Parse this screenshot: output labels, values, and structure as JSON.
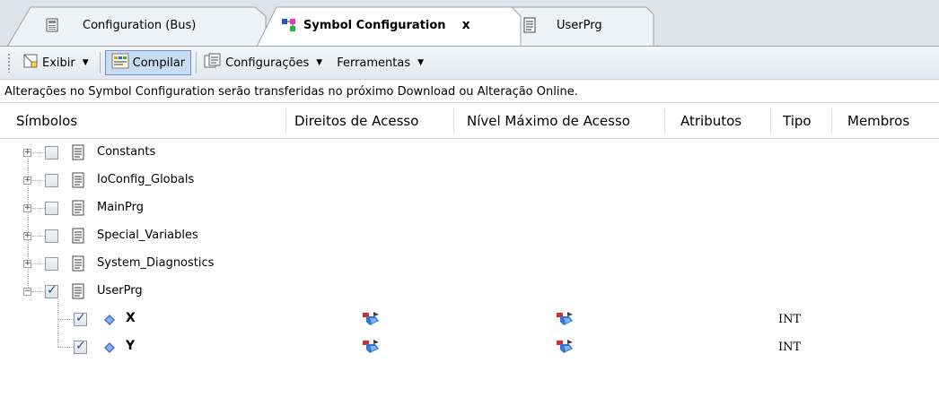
{
  "tabs": [
    {
      "label": "Configuration (Bus)",
      "icon": "bus-config-icon",
      "active": false
    },
    {
      "label": "Symbol Configuration",
      "icon": "symbol-config-icon",
      "active": true,
      "close": "x"
    },
    {
      "label": "UserPrg",
      "icon": "document-icon",
      "active": false
    }
  ],
  "toolbar": {
    "view_label": "Exibir",
    "compile_label": "Compilar",
    "settings_label": "Configurações",
    "tools_label": "Ferramentas"
  },
  "info_message": "Alterações no Symbol Configuration serão transferidas no próximo Download ou Alteração Online.",
  "columns": [
    "Símbolos",
    "Direitos de Acesso",
    "Nível Máximo de Acesso",
    "Atributos",
    "Tipo",
    "Membros"
  ],
  "tree": [
    {
      "label": "Constants",
      "expanded": false,
      "checked": false
    },
    {
      "label": "IoConfig_Globals",
      "expanded": false,
      "checked": false
    },
    {
      "label": "MainPrg",
      "expanded": false,
      "checked": false
    },
    {
      "label": "Special_Variables",
      "expanded": false,
      "checked": false
    },
    {
      "label": "System_Diagnostics",
      "expanded": false,
      "checked": false
    },
    {
      "label": "UserPrg",
      "expanded": true,
      "checked": true
    }
  ],
  "variables": [
    {
      "name": "X",
      "checked": true,
      "access": "read-write-icon",
      "max_access": "read-write-icon",
      "type": "INT"
    },
    {
      "name": "Y",
      "checked": true,
      "access": "read-write-icon",
      "max_access": "read-write-icon",
      "type": "INT"
    }
  ],
  "colors": {
    "tabstrip": "#dfe3ea",
    "pressed": "#c8dcf4",
    "accent": "#2c4a8c"
  }
}
